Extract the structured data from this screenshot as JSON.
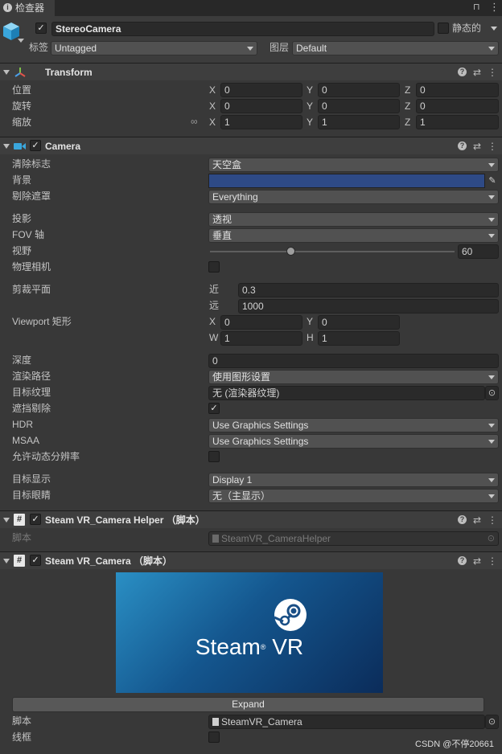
{
  "tab": {
    "title": "检查器",
    "icon": "info-icon",
    "menu_icon": "kebab-menu-icon"
  },
  "object": {
    "name": "StereoCamera",
    "static_label": "静态的",
    "tag_label": "标签",
    "tag_value": "Untagged",
    "layer_label": "图层",
    "layer_value": "Default"
  },
  "transform": {
    "title": "Transform",
    "position_label": "位置",
    "rotation_label": "旋转",
    "scale_label": "缩放",
    "position": {
      "x": "0",
      "y": "0",
      "z": "0"
    },
    "rotation": {
      "x": "0",
      "y": "0",
      "z": "0"
    },
    "scale": {
      "x": "1",
      "y": "1",
      "z": "1"
    }
  },
  "axes": {
    "x": "X",
    "y": "Y",
    "z": "Z",
    "w": "W",
    "h": "H"
  },
  "camera": {
    "title": "Camera",
    "clear_flags_label": "清除标志",
    "clear_flags_value": "天空盒",
    "background_label": "背景",
    "background_color": "#2e4a86",
    "culling_mask_label": "剔除遮罩",
    "culling_mask_value": "Everything",
    "projection_label": "投影",
    "projection_value": "透视",
    "fov_axis_label": "FOV 轴",
    "fov_axis_value": "垂直",
    "fov_label": "视野",
    "fov_value": "60",
    "fov_fraction": 0.33,
    "physical_label": "物理相机",
    "clipping_label": "剪裁平面",
    "near_label": "近",
    "near_value": "0.3",
    "far_label": "远",
    "far_value": "1000",
    "viewport_label": "Viewport 矩形",
    "viewport": {
      "x": "0",
      "y": "0",
      "w": "1",
      "h": "1"
    },
    "depth_label": "深度",
    "depth_value": "0",
    "render_path_label": "渲染路径",
    "render_path_value": "使用图形设置",
    "target_texture_label": "目标纹理",
    "target_texture_value": "无 (渲染器纹理)",
    "occlusion_label": "遮挡剔除",
    "hdr_label": "HDR",
    "hdr_value": "Use Graphics Settings",
    "msaa_label": "MSAA",
    "msaa_value": "Use Graphics Settings",
    "dynamic_res_label": "允许动态分辨率",
    "target_display_label": "目标显示",
    "target_display_value": "Display 1",
    "target_eye_label": "目标眼睛",
    "target_eye_value": "无（主显示）"
  },
  "helper": {
    "title": "Steam VR_Camera Helper  （脚本）",
    "script_label": "脚本",
    "script_value": "SteamVR_CameraHelper"
  },
  "steamvr_camera": {
    "title": "Steam VR_Camera  （脚本）",
    "logo_text": "Steam",
    "logo_vr": "VR",
    "expand_label": "Expand",
    "script_label": "脚本",
    "script_value": "SteamVR_Camera",
    "wireframe_label": "线框"
  },
  "watermark": "CSDN @不停20661"
}
